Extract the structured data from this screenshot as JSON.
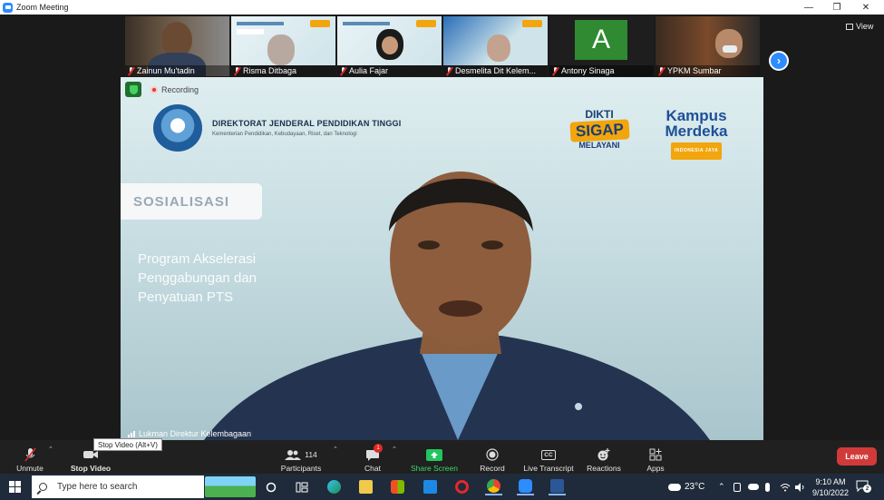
{
  "window": {
    "title": "Zoom Meeting"
  },
  "thumbnails": [
    {
      "name": "Zainun Mu'tadin"
    },
    {
      "name": "Risma Ditbaga"
    },
    {
      "name": "Aulia Fajar"
    },
    {
      "name": "Desmelita  Dit Kelem..."
    },
    {
      "name": "Antony Sinaga",
      "avatar_letter": "A"
    },
    {
      "name": "YPKM Sumbar"
    }
  ],
  "view_label": "View",
  "stage": {
    "recording_label": "Recording",
    "org_name": "DIREKTORAT JENDERAL PENDIDIKAN TINGGI",
    "org_sub": "Kementerian Pendidikan, Kebudayaan, Riset, dan Teknologi",
    "sigap_top": "DIKTI",
    "sigap_mid": "SIGAP",
    "sigap_bot": "MELAYANI",
    "kampus_line1": "Kampus",
    "kampus_line2": "Merdeka",
    "kampus_tag": "INDONESIA JAYA",
    "sosialisasi": "SOSIALISASI",
    "program_lines": [
      "Program Akselerasi",
      "Penggabungan dan",
      "Penyatuan PTS"
    ],
    "speaker_name": "Lukman Direktur Kelembagaan"
  },
  "toolbar": {
    "unmute": "Unmute",
    "stop_video": "Stop Video",
    "tooltip": "Stop Video (Alt+V)",
    "participants": "Participants",
    "participants_count": "114",
    "chat": "Chat",
    "chat_badge": "1",
    "share_screen": "Share Screen",
    "record": "Record",
    "live_transcript": "Live Transcript",
    "cc": "CC",
    "reactions": "Reactions",
    "apps": "Apps",
    "leave": "Leave"
  },
  "taskbar": {
    "search_placeholder": "Type here to search",
    "weather": "23°C",
    "time": "9:10 AM",
    "date": "9/10/2022",
    "notification_count": "2"
  },
  "colors": {
    "zoom_blue": "#2d8cff",
    "leave_red": "#d23a3a",
    "share_green": "#22c55e",
    "dikti_orange": "#f2a50c"
  }
}
